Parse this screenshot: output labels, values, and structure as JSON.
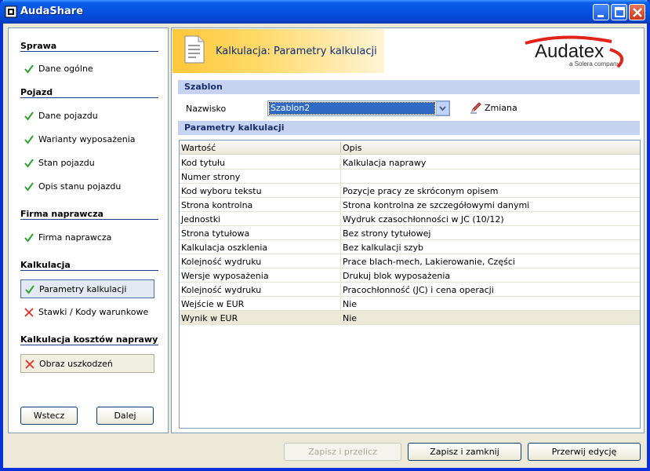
{
  "window": {
    "title": "AudaShare"
  },
  "sidebar": {
    "sections": [
      {
        "title": "Sprawa",
        "items": [
          {
            "label": "Dane ogólne",
            "status": "done"
          }
        ]
      },
      {
        "title": "Pojazd",
        "items": [
          {
            "label": "Dane pojazdu",
            "status": "done"
          },
          {
            "label": "Warianty wyposażenia",
            "status": "done"
          },
          {
            "label": "Stan pojazdu",
            "status": "done"
          },
          {
            "label": "Opis stanu pojazdu",
            "status": "done"
          }
        ]
      },
      {
        "title": "Firma naprawcza",
        "items": [
          {
            "label": "Firma naprawcza",
            "status": "done"
          }
        ]
      },
      {
        "title": "Kalkulacja",
        "items": [
          {
            "label": "Parametry kalkulacji",
            "status": "done"
          },
          {
            "label": "Stawki / Kody warunkowe",
            "status": "error"
          }
        ]
      },
      {
        "title": "Kalkulacja kosztów naprawy",
        "items": [
          {
            "label": "Obraz uszkodzeń",
            "status": "error"
          }
        ]
      }
    ],
    "back_label": "Wstecz",
    "next_label": "Dalej"
  },
  "header": {
    "title": "Kalkulacja: Parametry kalkulacji",
    "logo_text": "Audatex",
    "logo_sub": "a Solera company"
  },
  "template": {
    "band": "Szablon",
    "field_label": "Nazwisko",
    "selected": "Szablon2",
    "change_label": "Zmiana"
  },
  "params": {
    "band": "Parametry kalkulacji",
    "columns": [
      "Wartość",
      "Opis"
    ],
    "rows": [
      [
        "Kod tytułu",
        "Kalkulacja naprawy"
      ],
      [
        "Numer strony",
        ""
      ],
      [
        "Kod wyboru tekstu",
        "Pozycje pracy ze skróconym opisem"
      ],
      [
        "Strona kontrolna",
        "Strona kontrolna ze szczegółowymi danymi"
      ],
      [
        "Jednostki",
        "Wydruk czasochłonności w JC (10/12)"
      ],
      [
        "Strona tytułowa",
        "Bez strony tytułowej"
      ],
      [
        "Kalkulacja oszklenia",
        "Bez kalkulacji szyb"
      ],
      [
        "Kolejność wydruku",
        "Prace blach-mech, Lakierowanie, Części"
      ],
      [
        "Wersje wyposażenia",
        "Drukuj blok wyposażenia"
      ],
      [
        "Kolejność wydruku",
        "Pracochłonność (JC) i cena operacji"
      ],
      [
        "Wejście w EUR",
        "Nie"
      ],
      [
        "Wynik w EUR",
        "Nie"
      ]
    ],
    "selected_row": 11
  },
  "footer": {
    "save_print": "Zapisz i przelicz",
    "save_close": "Zapisz i zamknij",
    "cancel_edit": "Przerwij edycję"
  },
  "colors": {
    "accent": "#0831d9",
    "band": "#c5d3f0",
    "check": "#2fa12f",
    "cross": "#e0302a"
  }
}
